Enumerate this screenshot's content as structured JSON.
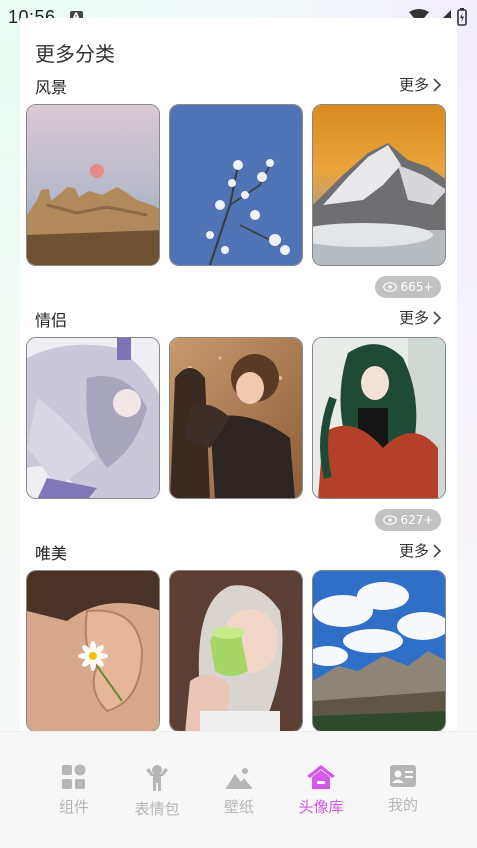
{
  "status_bar": {
    "time": "10:56",
    "notification_letter": "A"
  },
  "page": {
    "title": "更多分类"
  },
  "sections": [
    {
      "title": "风景",
      "more_label": "更多",
      "views": "665+",
      "images": [
        "pink-moon-over-rocks",
        "white-blossoms-blue-sky",
        "snowy-mountain-sunset"
      ]
    },
    {
      "title": "情侣",
      "more_label": "更多",
      "views": "627+",
      "images": [
        "anime-couple-silver-hair",
        "illustrated-couple-sparkles",
        "girl-green-hair-red-coat"
      ]
    },
    {
      "title": "唯美",
      "more_label": "更多",
      "images": [
        "ear-with-daisy",
        "girl-with-green-drink",
        "mountains-blue-sky-clouds"
      ]
    }
  ],
  "tabbar": {
    "items": [
      {
        "label": "组件",
        "icon": "widgets-icon",
        "active": false
      },
      {
        "label": "表情包",
        "icon": "person-emoji-icon",
        "active": false
      },
      {
        "label": "壁纸",
        "icon": "landscape-icon",
        "active": false
      },
      {
        "label": "头像库",
        "icon": "home-icon",
        "active": true
      },
      {
        "label": "我的",
        "icon": "id-card-icon",
        "active": false
      }
    ]
  },
  "colors": {
    "accent": "#d25ae6",
    "inactive": "#b6b6b6",
    "badge": "#c2c2c2"
  }
}
